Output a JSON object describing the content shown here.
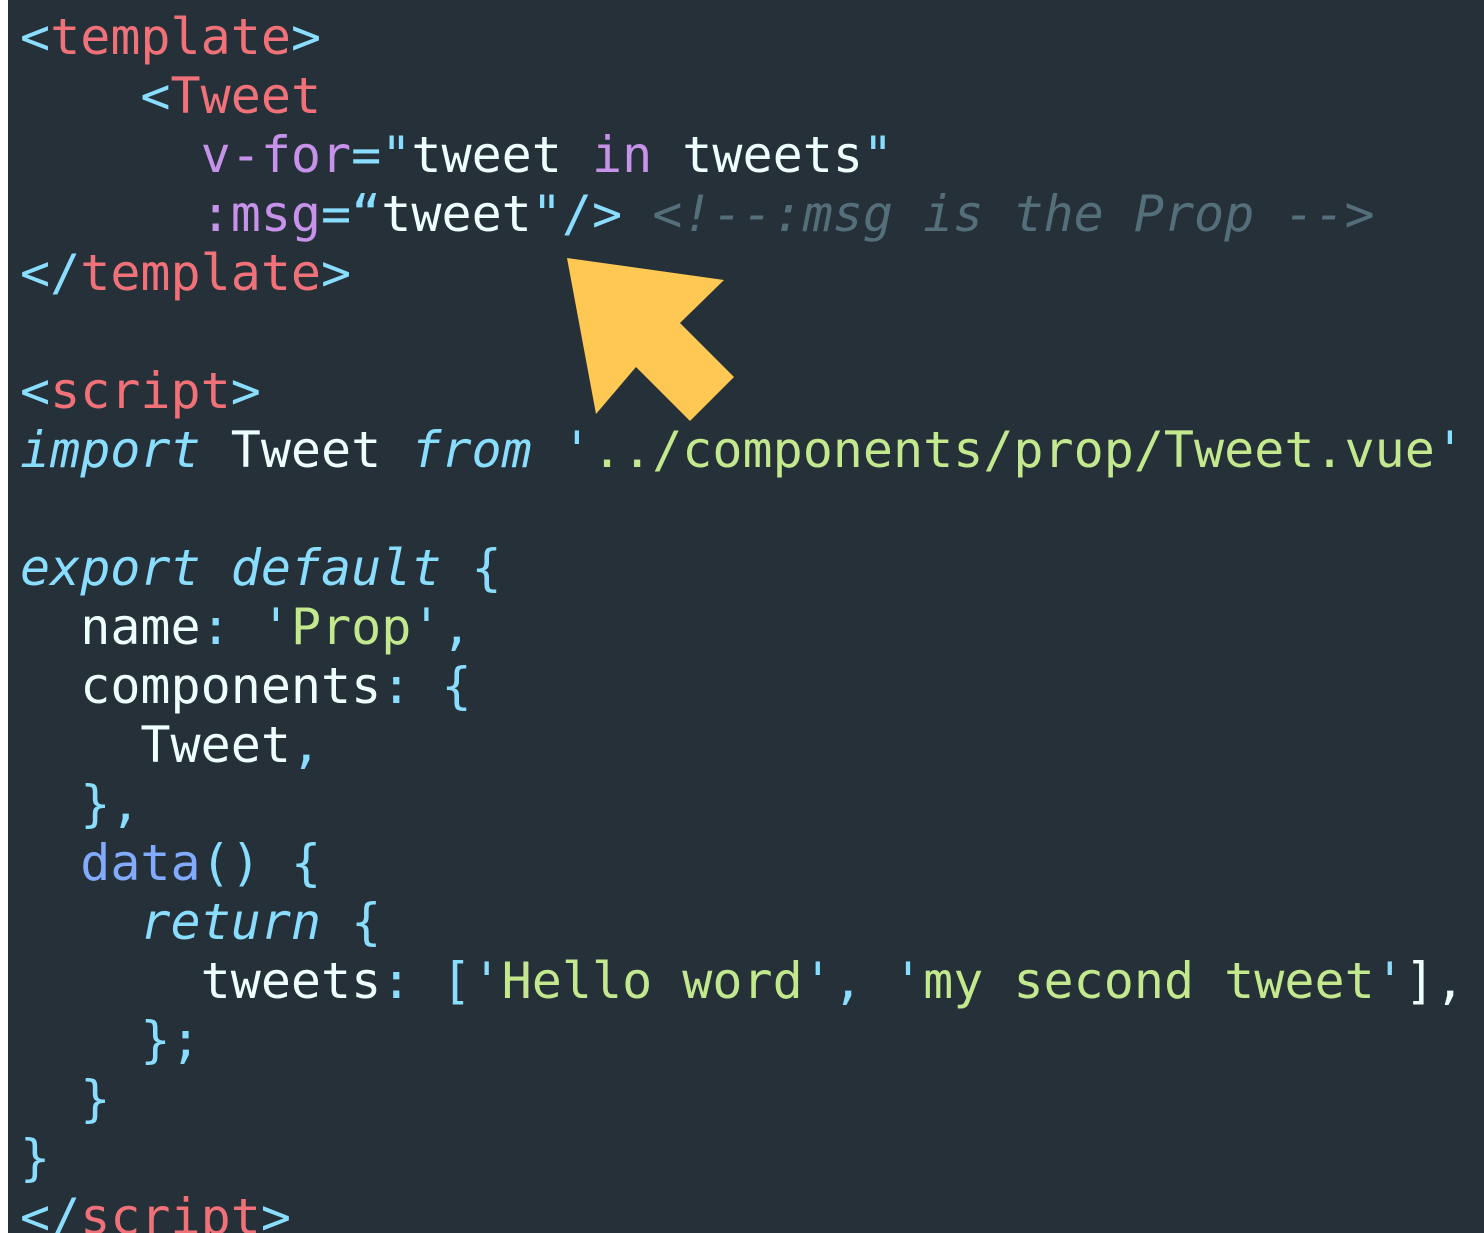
{
  "accent_color": "#fec853",
  "editor_background": "#263038",
  "annotation": {
    "arrow_icon": "pointer-arrow-icon"
  },
  "code": {
    "l1": {
      "t1": "<",
      "t2": "template",
      "t3": ">"
    },
    "l2": {
      "indent": "    ",
      "t1": "<",
      "t2": "Tweet"
    },
    "l3": {
      "indent": "      ",
      "t1": "v-for",
      "t2": "=\"",
      "t3": "tweet",
      "t4": " ",
      "t5": "in",
      "t6": " tweets",
      "t7": "\""
    },
    "l4": {
      "indent": "      ",
      "t1": ":msg",
      "t2": "=“",
      "t3": "tweet",
      "t4": "\"/>",
      "t5": " <!--:msg is the Prop -->"
    },
    "l5": {
      "t1": "</",
      "t2": "template",
      "t3": ">"
    },
    "l7": {
      "t1": "<",
      "t2": "script",
      "t3": ">"
    },
    "l8": {
      "t1": "import",
      "t2": " Tweet ",
      "t3": "from",
      "t4": " ",
      "t5": "'",
      "t6": "../components/prop/Tweet.vue",
      "t7": "'"
    },
    "l10": {
      "t1": "export",
      "t2": " ",
      "t3": "default",
      "t4": " {"
    },
    "l11": {
      "indent": "  ",
      "t1": "name",
      "t2": ": ",
      "t3": "'",
      "t4": "Prop",
      "t5": "'",
      "t6": ","
    },
    "l12": {
      "indent": "  ",
      "t1": "components",
      "t2": ": {"
    },
    "l13": {
      "indent": "    ",
      "t1": "Tweet",
      "t2": ","
    },
    "l14": {
      "indent": "  ",
      "t1": "},"
    },
    "l15": {
      "indent": "  ",
      "t1": "data",
      "t2": "() {"
    },
    "l16": {
      "indent": "    ",
      "t1": "return",
      "t2": " {"
    },
    "l17": {
      "indent": "      ",
      "t1": "tweets",
      "t2": ": [",
      "t3": "'",
      "t4": "Hello word",
      "t5": "'",
      "t6": ", ",
      "t7": "'",
      "t8": "my second tweet",
      "t9": "'",
      "t10": "],"
    },
    "l18": {
      "indent": "    ",
      "t1": "};"
    },
    "l19": {
      "indent": "  ",
      "t1": "}"
    },
    "l20": {
      "t1": "}"
    },
    "l21": {
      "t1": "</",
      "t2": "script",
      "t3": ">"
    }
  }
}
